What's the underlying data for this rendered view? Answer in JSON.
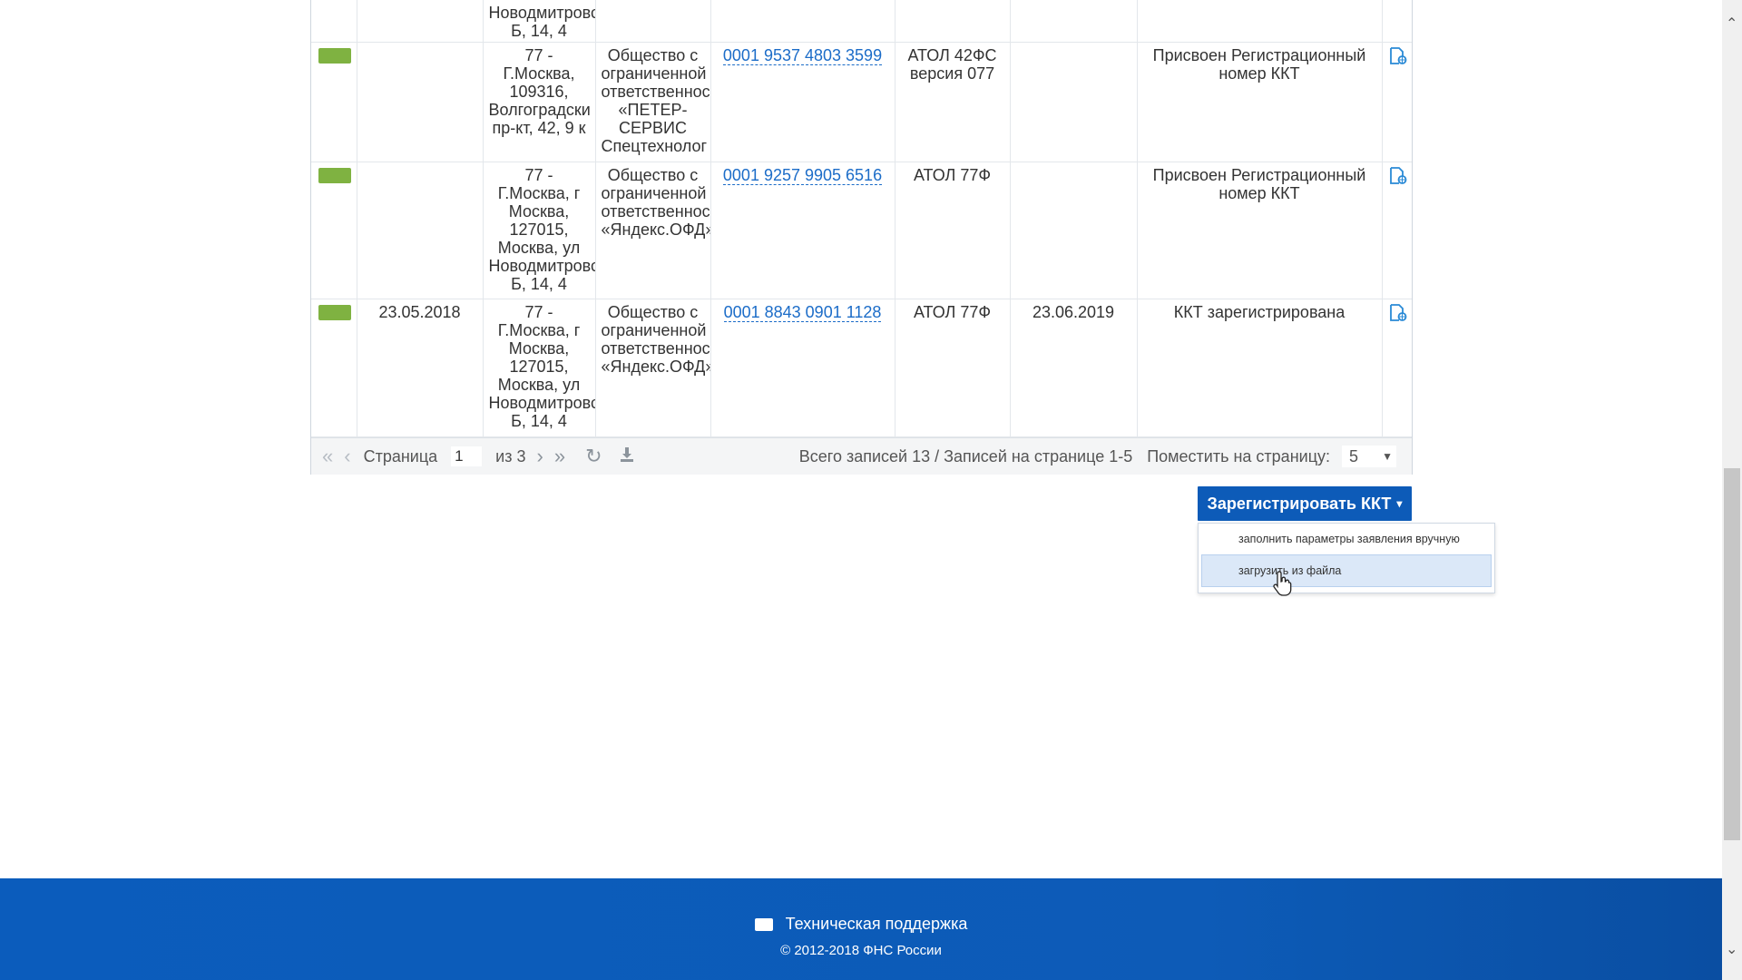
{
  "rows": [
    {
      "date": "",
      "address": [
        "Новодмитровс",
        "Б, 14, 4"
      ],
      "org": [],
      "number": "",
      "model": [],
      "end_date": "",
      "status": [],
      "partial": true
    },
    {
      "date": "",
      "address": [
        "77 -",
        "Г.Москва,",
        "109316,",
        "Волгоградски",
        "пр-кт, 42, 9 к"
      ],
      "org": [
        "Общество с",
        "ограниченной",
        "ответственнос",
        "«ПЕТЕР-",
        "СЕРВИС",
        "Спецтехнолог"
      ],
      "number": "0001 9537 4803 3599",
      "model": [
        "АТОЛ 42ФС",
        "версия 077"
      ],
      "end_date": "",
      "status": [
        "Присвоен Регистрационный",
        "номер ККТ"
      ]
    },
    {
      "date": "",
      "address": [
        "77 -",
        "Г.Москва, г",
        "Москва,",
        "127015,",
        "Москва, ул",
        "Новодмитровс",
        "Б, 14, 4"
      ],
      "org": [
        "Общество с",
        "ограниченной",
        "ответственнос",
        "«Яндекс.ОФД»"
      ],
      "number": "0001 9257 9905 6516",
      "model": [
        "АТОЛ 77Ф"
      ],
      "end_date": "",
      "status": [
        "Присвоен Регистрационный",
        "номер ККТ"
      ]
    },
    {
      "date": "23.05.2018",
      "address": [
        "77 -",
        "Г.Москва, г",
        "Москва,",
        "127015,",
        "Москва, ул",
        "Новодмитровс",
        "Б, 14, 4"
      ],
      "org": [
        "Общество с",
        "ограниченной",
        "ответственнос",
        "«Яндекс.ОФД»"
      ],
      "number": "0001 8843 0901 1128",
      "model": [
        "АТОЛ 77Ф"
      ],
      "end_date": "23.06.2019",
      "status": [
        "ККТ зарегистрирована"
      ]
    }
  ],
  "pager": {
    "page_label": "Страница",
    "page_value": "1",
    "of_label": "из 3",
    "summary": "Всего записей 13 / Записей на странице 1-5",
    "per_page_label": "Поместить на страницу:",
    "per_page_value": "5"
  },
  "register_button": {
    "label": "Зарегистрировать ККТ"
  },
  "dropdown": {
    "items": [
      "заполнить параметры заявления вручную",
      "загрузить из файла"
    ]
  },
  "footer": {
    "support": "Техническая поддержка",
    "copyright": "© 2012-2018 ФНС России"
  },
  "colors": {
    "status_chip": "#7fb241",
    "link": "#1b6cc8",
    "primary_button": "#0d5bb8",
    "footer_bg": "#0b5cbc"
  },
  "icons": [
    "document-view-icon",
    "first-page-icon",
    "prev-page-icon",
    "next-page-icon",
    "last-page-icon",
    "refresh-icon",
    "download-icon",
    "chevron-down-icon",
    "mail-icon"
  ]
}
